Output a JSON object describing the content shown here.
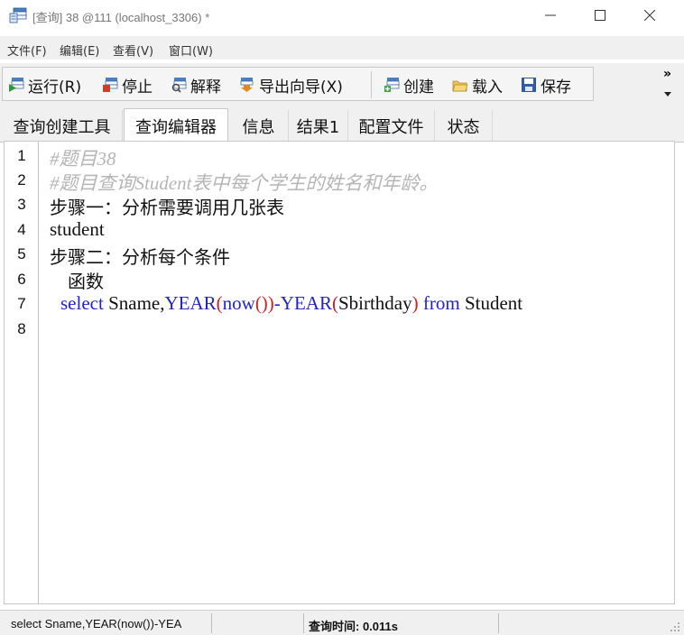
{
  "window": {
    "title": "[查询] 38 @111 (localhost_3306) *"
  },
  "menu": {
    "items": [
      "文件(F)",
      "编辑(E)",
      "查看(V)",
      "窗口(W)"
    ]
  },
  "toolbar": {
    "run_label": "运行(R)",
    "stop_label": "停止",
    "explain_label": "解释",
    "export_label": "导出向导(X)",
    "create_label": "创建",
    "load_label": "载入",
    "save_label": "保存",
    "more_label": "»"
  },
  "tabs": [
    {
      "label": "查询创建工具"
    },
    {
      "label": "查询编辑器",
      "active": true
    },
    {
      "label": "信息"
    },
    {
      "label": "结果1"
    },
    {
      "label": "配置文件"
    },
    {
      "label": "状态"
    }
  ],
  "editor": {
    "line_numbers": [
      "1",
      "2",
      "3",
      "4",
      "5",
      "6",
      "7",
      "8"
    ],
    "line1": "#题目38",
    "line2": "#题目查询Student表中每个学生的姓名和年龄。",
    "line3": "步骤一：分析需要调用几张表",
    "line4": "student",
    "line5": "步骤二：分析每个条件",
    "line6": "函数",
    "line7": {
      "kw_select": "select",
      "t1": " Sname,",
      "fn_year1": "YEAR",
      "p1": "(",
      "fn_now": "now",
      "p2": "())",
      "minus": "-",
      "fn_year2": "YEAR",
      "p3": "(",
      "arg": "Sbirthday",
      "p4": ")",
      "sp": " ",
      "kw_from": "from",
      "table": " Student"
    }
  },
  "status": {
    "sql_preview": "select Sname,YEAR(now())-YEA",
    "query_time": "查询时间: 0.011s"
  },
  "colors": {
    "keyword": "#2222cc",
    "paren": "#cc2222",
    "comment": "#b5b5b5"
  }
}
